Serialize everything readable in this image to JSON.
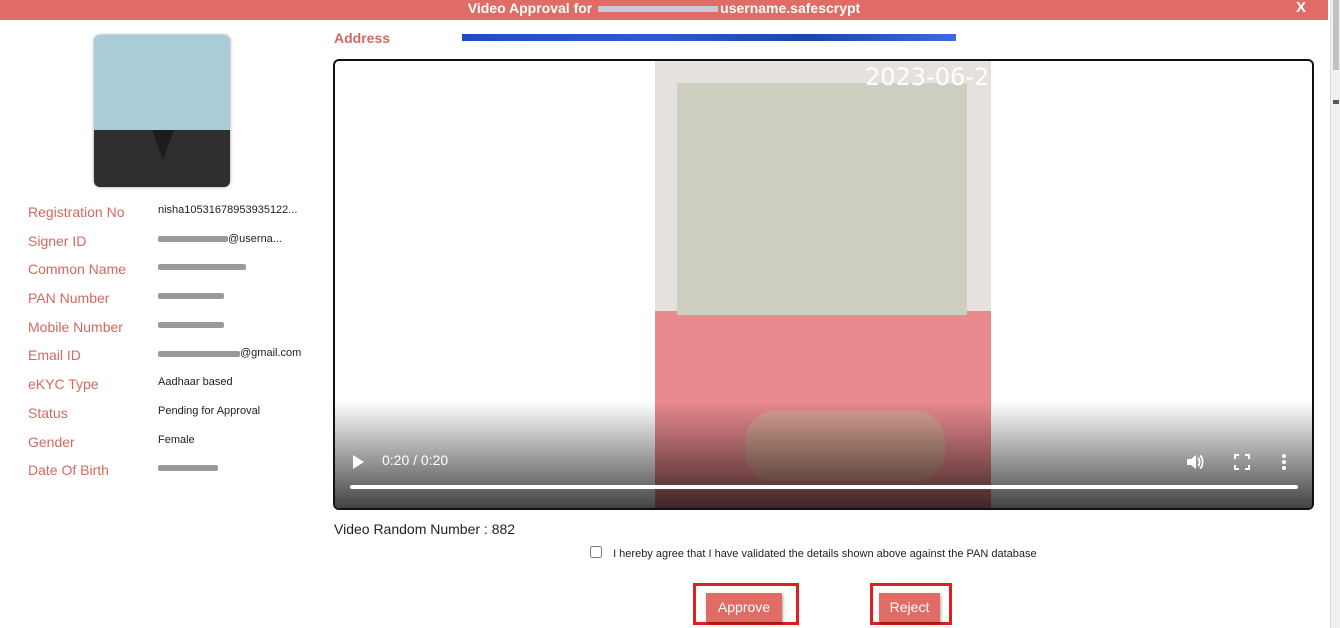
{
  "dialog": {
    "title_prefix": "Video Approval for",
    "title_suffix": "username.safescrypt",
    "close_label": "X"
  },
  "address": {
    "label": "Address"
  },
  "details": [
    {
      "label": "Registration No",
      "value": "nisha10531678953935122..."
    },
    {
      "label": "Signer ID",
      "value": "@userna..."
    },
    {
      "label": "Common Name",
      "value": ""
    },
    {
      "label": "PAN Number",
      "value": ""
    },
    {
      "label": "Mobile Number",
      "value": ""
    },
    {
      "label": "Email ID",
      "value": "@gmail.com"
    },
    {
      "label": "eKYC Type",
      "value": "Aadhaar based"
    },
    {
      "label": "Status",
      "value": "Pending for Approval"
    },
    {
      "label": "Gender",
      "value": "Female"
    },
    {
      "label": "Date Of Birth",
      "value": ""
    }
  ],
  "video": {
    "timestamp_overlay": "2023-06-2",
    "time_display": "0:20 / 0:20",
    "progress": 1.0,
    "icons": [
      "play-icon",
      "volume-icon",
      "fullscreen-icon",
      "more-options-icon"
    ]
  },
  "random_number": {
    "text": "Video Random Number : 882"
  },
  "agreement": {
    "text": "I hereby agree that I have validated the details shown above against the PAN database",
    "checked": false
  },
  "actions": {
    "approve_label": "Approve",
    "reject_label": "Reject"
  },
  "colors": {
    "accent": "#e06c66",
    "label": "#d26a5f",
    "highlight_border": "#e02020"
  }
}
